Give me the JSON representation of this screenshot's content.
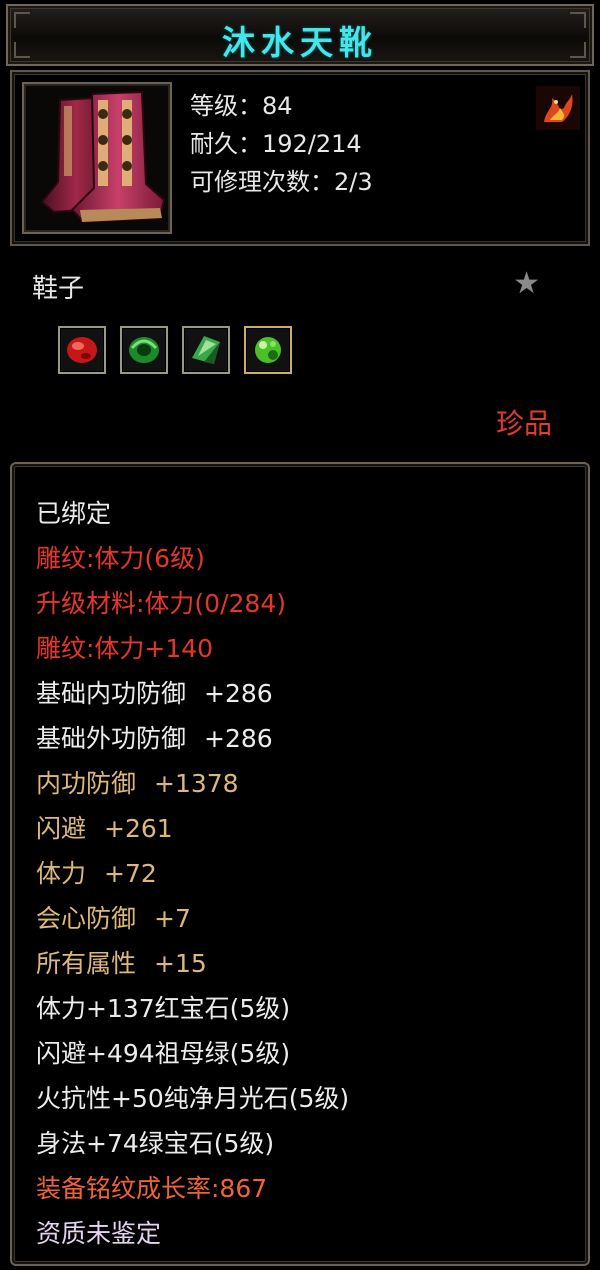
{
  "item": {
    "name": "沐水天靴",
    "level_line": "等级：84",
    "durability_line": "耐久：192/214",
    "repair_line": "可修理次数：2/3",
    "type": "鞋子",
    "rarity": "珍品"
  },
  "icons": {
    "item": "boots-icon",
    "school": "flame-emblem-icon",
    "star": "star-icon",
    "gems": [
      "ruby-gem-icon",
      "emerald-gem-icon",
      "moonstone-gem-icon",
      "green-gem-icon"
    ]
  },
  "attributes": {
    "bound": "已绑定",
    "engrave_level": "雕纹:体力(6级)",
    "upgrade_material": "升级材料:体力(0/284)",
    "engrave_bonus": "雕纹:体力+140",
    "base_inner_def_label": "基础内功防御",
    "base_inner_def_value": "+286",
    "base_outer_def_label": "基础外功防御",
    "base_outer_def_value": "+286",
    "inner_def_label": "内功防御",
    "inner_def_value": "+1378",
    "dodge_label": "闪避",
    "dodge_value": "+261",
    "stamina_label": "体力",
    "stamina_value": "+72",
    "crit_def_label": "会心防御",
    "crit_def_value": "+7",
    "all_attr_label": "所有属性",
    "all_attr_value": "+15",
    "gem_1": "体力+137红宝石(5级)",
    "gem_2": "闪避+494祖母绿(5级)",
    "gem_3": "火抗性+50纯净月光石(5级)",
    "gem_4": "身法+74绿宝石(5级)",
    "growth_rate": "装备铭纹成长率:867",
    "aptitude": "资质未鉴定"
  },
  "colors": {
    "title": "#45e6ea",
    "white": "#ececec",
    "red": "#e6362a",
    "tan": "#ddb87a",
    "orange": "#f0623a",
    "rarity": "#e23a2e"
  }
}
